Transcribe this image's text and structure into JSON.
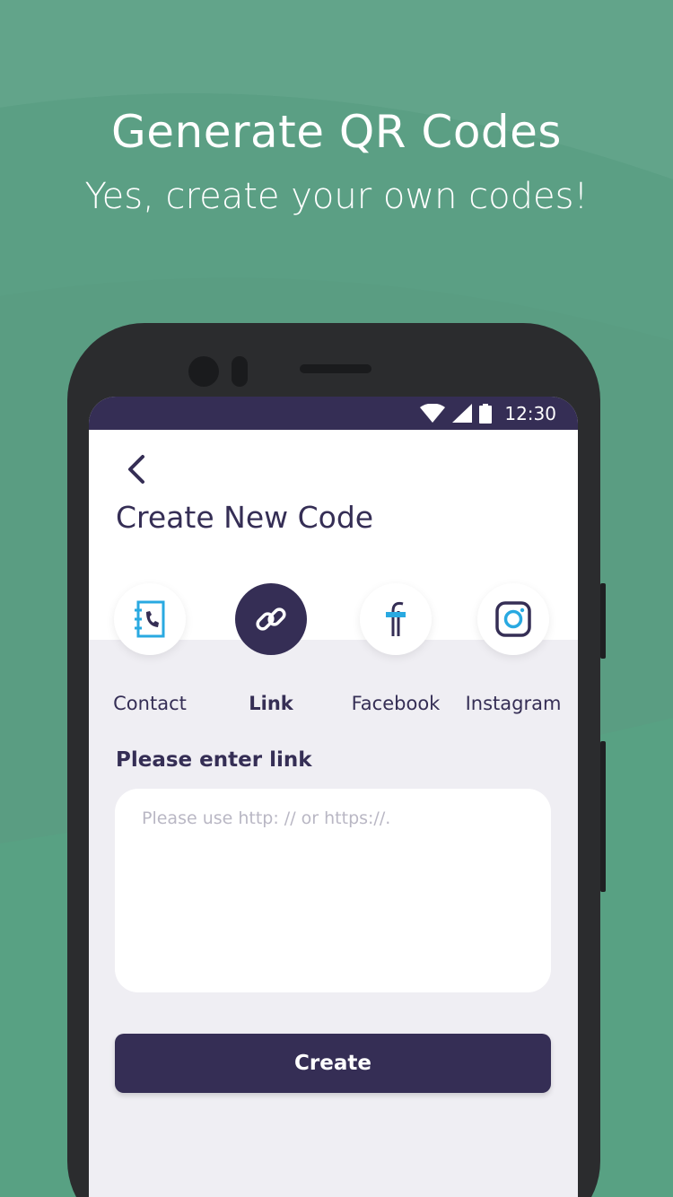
{
  "promo": {
    "title": "Generate QR Codes",
    "subtitle": "Yes, create your own codes!"
  },
  "status_bar": {
    "time": "12:30",
    "icons": [
      "wifi-icon",
      "cellular-signal-icon",
      "battery-icon"
    ]
  },
  "screen": {
    "back_icon": "chevron-left-icon",
    "title": "Create New Code",
    "code_types": [
      {
        "label": "Contact",
        "icon": "contact-book-icon",
        "active": false
      },
      {
        "label": "Link",
        "icon": "link-icon",
        "active": true
      },
      {
        "label": "Facebook",
        "icon": "facebook-icon",
        "active": false
      },
      {
        "label": "Instagram",
        "icon": "instagram-icon",
        "active": false
      }
    ],
    "field_label": "Please enter link",
    "link_input": {
      "value": "",
      "placeholder": "Please use http: // or https://."
    },
    "create_label": "Create"
  },
  "colors": {
    "background": "#5a9d82",
    "primary": "#352e55",
    "accent": "#29a9e1",
    "screen_bg": "#efeef3"
  }
}
